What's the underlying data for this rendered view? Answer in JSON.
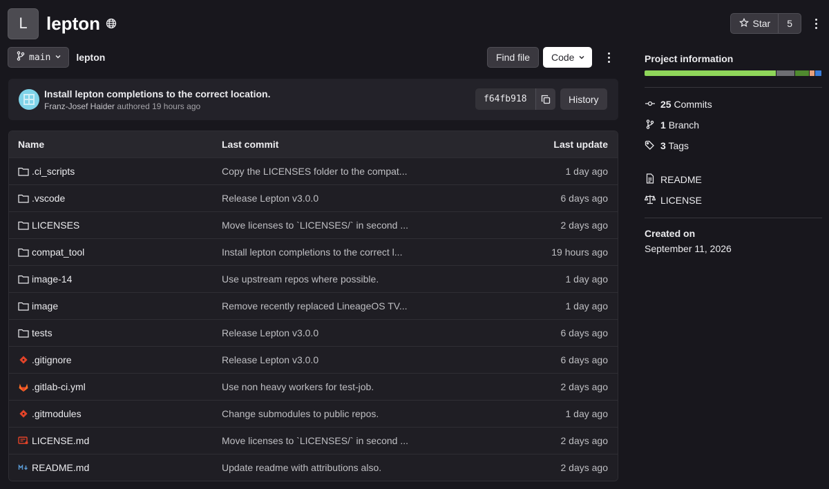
{
  "project": {
    "avatar_letter": "L",
    "name": "lepton",
    "star_label": "Star",
    "star_count": "5"
  },
  "branch": {
    "name": "main",
    "breadcrumb": "lepton"
  },
  "toolbar": {
    "find_file": "Find file",
    "code": "Code"
  },
  "commit": {
    "title": "Install lepton completions to the correct location.",
    "author": "Franz-Josef Haider",
    "authored": "authored",
    "time": "19 hours ago",
    "sha": "f64fb918",
    "history": "History"
  },
  "table": {
    "headers": {
      "name": "Name",
      "commit": "Last commit",
      "date": "Last update"
    },
    "rows": [
      {
        "name": ".ci_scripts",
        "icon": "folder-icon",
        "commit": "Copy the LICENSES folder to the compat...",
        "date": "1 day ago"
      },
      {
        "name": ".vscode",
        "icon": "folder-icon",
        "commit": "Release Lepton v3.0.0",
        "date": "6 days ago"
      },
      {
        "name": "LICENSES",
        "icon": "folder-icon",
        "commit": "Move licenses to `LICENSES/` in second ...",
        "date": "2 days ago"
      },
      {
        "name": "compat_tool",
        "icon": "folder-icon",
        "commit": "Install lepton completions to the correct l...",
        "date": "19 hours ago"
      },
      {
        "name": "image-14",
        "icon": "folder-icon",
        "commit": "Use upstream repos where possible.",
        "date": "1 day ago"
      },
      {
        "name": "image",
        "icon": "folder-icon",
        "commit": "Remove recently replaced LineageOS TV...",
        "date": "1 day ago"
      },
      {
        "name": "tests",
        "icon": "folder-icon",
        "commit": "Release Lepton v3.0.0",
        "date": "6 days ago"
      },
      {
        "name": ".gitignore",
        "icon": "git-icon",
        "commit": "Release Lepton v3.0.0",
        "date": "6 days ago"
      },
      {
        "name": ".gitlab-ci.yml",
        "icon": "gitlab-icon",
        "commit": "Use non heavy workers for test-job.",
        "date": "2 days ago"
      },
      {
        "name": ".gitmodules",
        "icon": "git-icon",
        "commit": "Change submodules to public repos.",
        "date": "1 day ago"
      },
      {
        "name": "LICENSE.md",
        "icon": "license-file-icon",
        "commit": "Move licenses to `LICENSES/` in second ...",
        "date": "2 days ago"
      },
      {
        "name": "README.md",
        "icon": "markdown-icon",
        "commit": "Update readme with attributions also.",
        "date": "2 days ago"
      }
    ]
  },
  "sidebar": {
    "project_info_title": "Project information",
    "languages": [
      {
        "color": "#8fd65a",
        "share": 0.82
      },
      {
        "color": "#6e6e73",
        "share": 0.11
      },
      {
        "color": "#4f8a2f",
        "share": 0.085
      },
      {
        "color": "#e6a07c",
        "share": 0.03
      },
      {
        "color": "#3b7dd8",
        "share": 0.04
      }
    ],
    "commits_count": "25",
    "commits_label": "Commits",
    "branch_count": "1",
    "branch_label": "Branch",
    "tags_count": "3",
    "tags_label": "Tags",
    "readme": "README",
    "license": "LICENSE",
    "created_label": "Created on",
    "created_date": "September 11, 2026"
  },
  "colors": {
    "background": "#18171d",
    "git_icon": "#e24329",
    "gitlab_icon": "#fc6d26",
    "markdown_icon": "#5b9bd5"
  }
}
